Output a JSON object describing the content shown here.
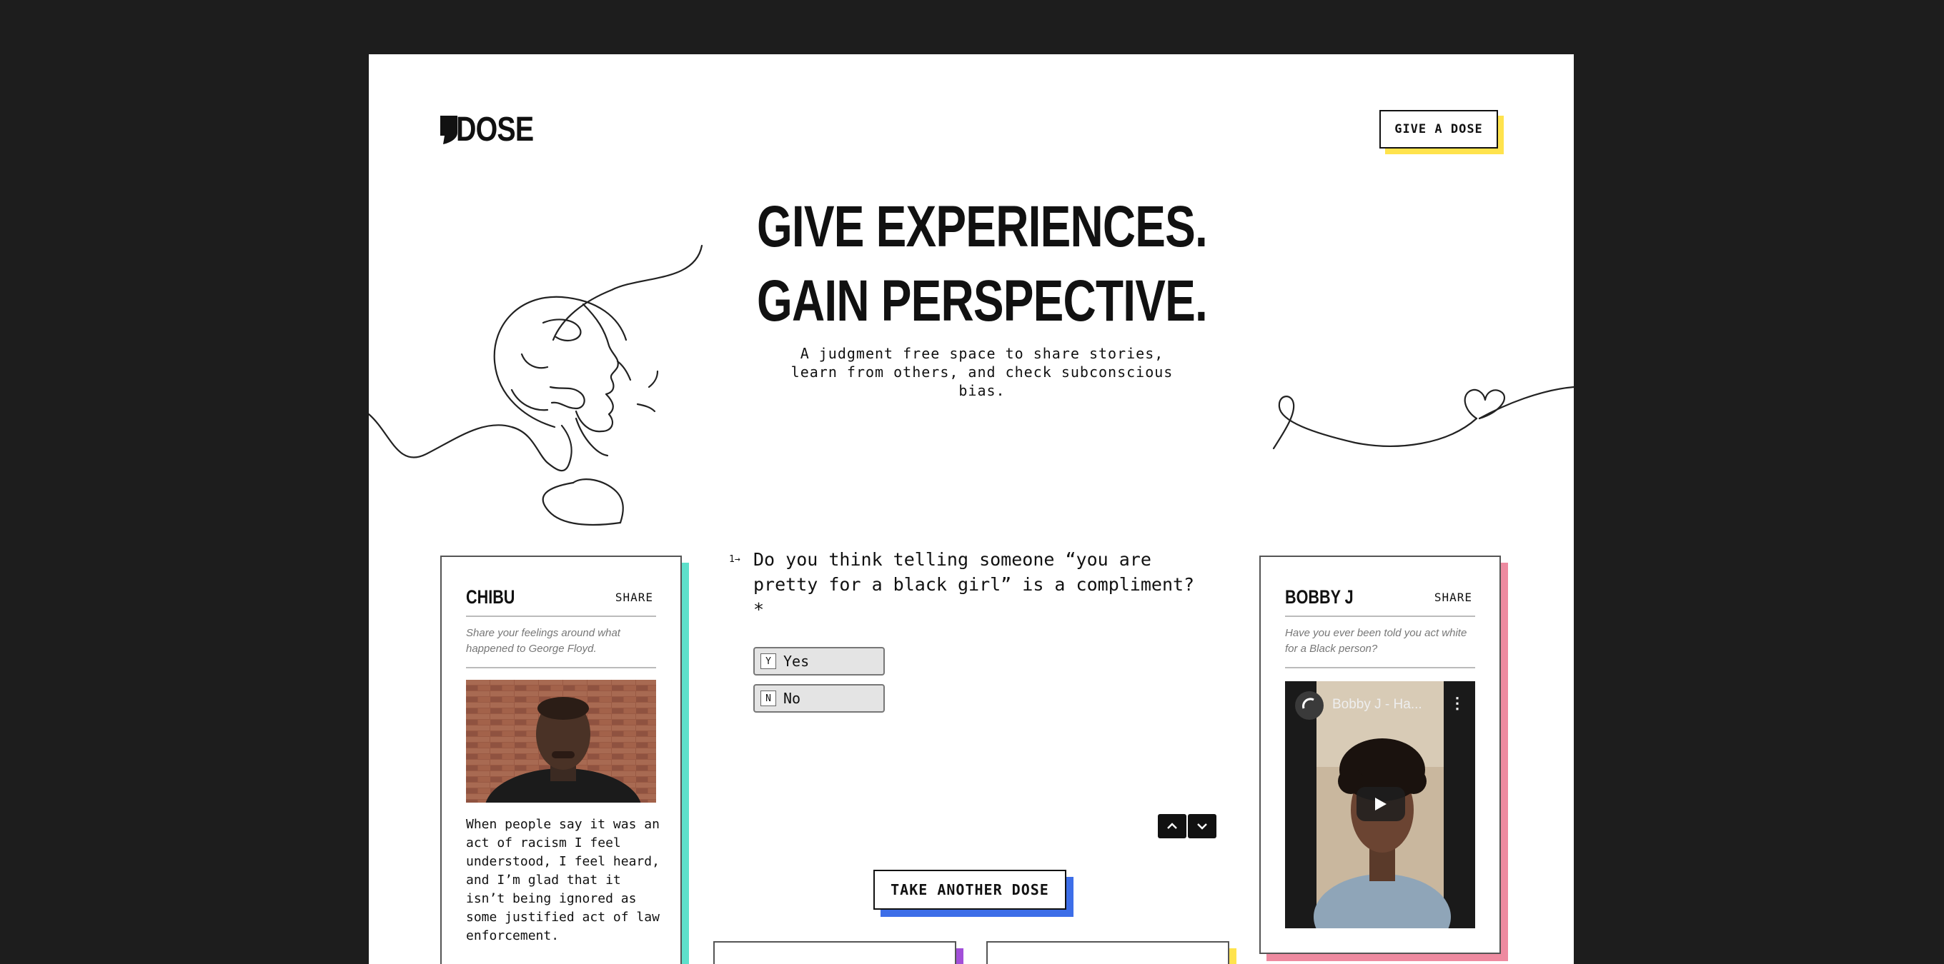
{
  "header": {
    "logo_text": "DOSE",
    "cta_label": "GIVE A DOSE"
  },
  "hero": {
    "title_line1": "GIVE EXPERIENCES.",
    "title_line2": "GAIN PERSPECTIVE.",
    "subtitle": "A judgment free space to share stories, learn from others, and check subconscious bias."
  },
  "left_card": {
    "name": "CHIBU",
    "share_label": "SHARE",
    "prompt": "Share your feelings around what happened to George Floyd.",
    "quote": "When people say it was an act of racism I feel understood, I feel heard, and I’m glad that it isn’t being ignored as some justified act of law enforcement.",
    "accent": "#5de0cb"
  },
  "right_card": {
    "name": "BOBBY J",
    "share_label": "SHARE",
    "prompt": "Have you ever been told you act white for a Black person?",
    "video_title": "Bobby J - Ha...",
    "accent": "#ee8aa0"
  },
  "quiz": {
    "number": "1",
    "question": "Do you think telling someone “you are pretty for a black girl” is a compliment? *",
    "choices": [
      {
        "key": "Y",
        "label": "Yes"
      },
      {
        "key": "N",
        "label": "No"
      }
    ]
  },
  "footer": {
    "take_another_label": "TAKE ANOTHER DOSE"
  },
  "colors": {
    "yellow": "#ffe34d",
    "blue": "#3d6ee8",
    "purple": "#a24fd8",
    "teal": "#5de0cb",
    "pink": "#ee8aa0"
  }
}
